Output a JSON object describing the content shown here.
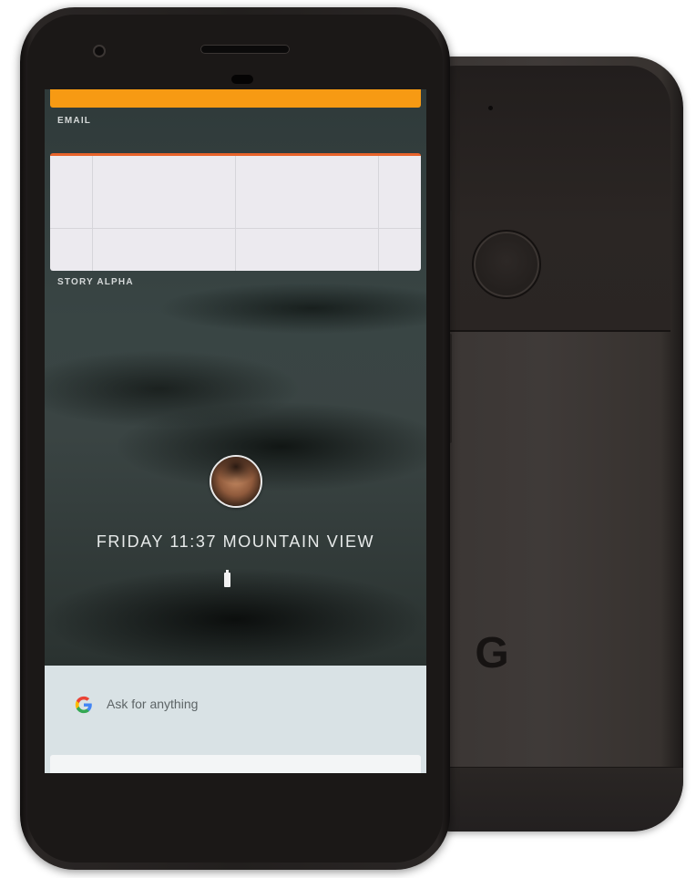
{
  "screen": {
    "email_label": "EMAIL",
    "story_label": "STORY ALPHA",
    "lock_info": "FRIDAY 11:37 MOUNTAIN VIEW",
    "search_placeholder": "Ask for anything"
  },
  "back": {
    "logo": "G"
  },
  "icons": {
    "google": "google-g-icon",
    "battery": "battery-icon",
    "avatar": "user-avatar"
  },
  "colors": {
    "top_card_accent": "#f79a13",
    "email_card_accent": "#e8632b",
    "search_panel": "#d9e2e5",
    "google_blue": "#4285f4",
    "google_red": "#ea4335",
    "google_yellow": "#fbbc05",
    "google_green": "#34a853"
  }
}
